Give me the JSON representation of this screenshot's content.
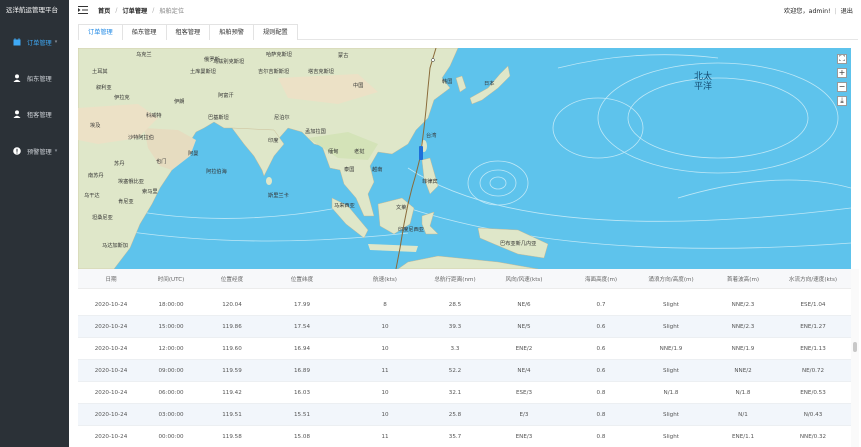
{
  "app": {
    "title": "远洋航运管理平台"
  },
  "sidebar": {
    "items": [
      {
        "label": "订单管理",
        "icon": "calendar-icon"
      },
      {
        "label": "船东管理",
        "icon": "user-icon"
      },
      {
        "label": "租客管理",
        "icon": "person-icon"
      },
      {
        "label": "预警管理",
        "icon": "alert-icon"
      }
    ]
  },
  "header": {
    "breadcrumb": [
      "首页",
      "订单管理",
      "船舶定位"
    ],
    "welcome": "欢迎您，admin!",
    "logout": "退出"
  },
  "tabs": [
    "订单管理",
    "船东管理",
    "租客管理",
    "船舶预警",
    "规则配置"
  ],
  "map": {
    "labels": {
      "kazakh": "哈萨克斯坦",
      "mongolia": "蒙古",
      "japan": "日本",
      "korea": "韩国",
      "china": "中国",
      "turkey": "土耳其",
      "iran": "伊朗",
      "afghanistan": "阿富汗",
      "pakistan": "巴基斯坦",
      "india": "印度",
      "saudi": "沙特阿拉伯",
      "egypt": "埃及",
      "yemen": "也门",
      "oman": "阿曼",
      "thailand": "泰国",
      "vietnam": "越南",
      "philippines": "菲律宾",
      "malaysia": "马来西亚",
      "indonesia": "印度尼西亚",
      "png": "巴布亚新几内亚",
      "srilanka": "斯里兰卡",
      "arabian_sea": "阿拉伯海",
      "ethiopia": "埃塞俄比亚",
      "kenya": "肯尼亚",
      "bangladesh": "孟加拉国",
      "nepal": "尼泊尔",
      "myanmar": "缅甸",
      "laos": "老挝",
      "taiwan": "台湾",
      "iraq": "伊拉克",
      "syria": "叙利亚",
      "uzbek": "乌兹别克斯坦",
      "turkmen": "土库曼斯坦",
      "kyrgyz": "吉尔吉斯斯坦",
      "tajik": "塔吉克斯坦",
      "ukraine": "乌克兰",
      "somalia": "索马里",
      "tanzania": "坦桑尼亚",
      "madagascar": "马达加斯加",
      "brunei": "文莱",
      "sudan": "苏丹",
      "south_sudan": "南苏丹",
      "russia": "俄罗斯",
      "uganda": "乌干达",
      "kuwait": "科威特"
    },
    "ocean_label": "北太平洋",
    "zoom_in": "+",
    "zoom_out": "−"
  },
  "table": {
    "headers": [
      "日期",
      "时间(UTC)",
      "位置经度",
      "位置纬度",
      "航速(kts)",
      "总航行距离(nm)",
      "风向/风速(kts)",
      "海面高度(m)",
      "涌浪方向/高度(m)",
      "首着波高(m)",
      "水流方向/速度(kts)"
    ],
    "rows": [
      [
        "2020-10-24",
        "18:00:00",
        "120.04",
        "17.99",
        "8",
        "28.5",
        "NE/6",
        "0.7",
        "Slight",
        "NNE/2.3",
        "ESE/1.04"
      ],
      [
        "2020-10-24",
        "15:00:00",
        "119.86",
        "17.54",
        "10",
        "39.3",
        "NE/5",
        "0.6",
        "Slight",
        "NNE/2.3",
        "ENE/1.27"
      ],
      [
        "2020-10-24",
        "12:00:00",
        "119.60",
        "16.94",
        "10",
        "3.3",
        "ENE/2",
        "0.6",
        "NNE/1.9",
        "NNE/1.9",
        "ENE/1.13"
      ],
      [
        "2020-10-24",
        "09:00:00",
        "119.59",
        "16.89",
        "11",
        "52.2",
        "NE/4",
        "0.6",
        "Slight",
        "NNE/2",
        "NE/0.72"
      ],
      [
        "2020-10-24",
        "06:00:00",
        "119.42",
        "16.03",
        "10",
        "32.1",
        "ESE/3",
        "0.8",
        "N/1.8",
        "N/1.8",
        "ENE/0.53"
      ],
      [
        "2020-10-24",
        "03:00:00",
        "119.51",
        "15.51",
        "10",
        "25.8",
        "E/3",
        "0.8",
        "Slight",
        "N/1",
        "N/0.43"
      ],
      [
        "2020-10-24",
        "00:00:00",
        "119.58",
        "15.08",
        "11",
        "35.7",
        "ENE/3",
        "0.8",
        "Slight",
        "ENE/1.1",
        "NNE/0.32"
      ]
    ]
  },
  "colors": {
    "sidebar": "#2b3137",
    "accent": "#1e88e5",
    "sea": "#5ec3ec",
    "land": "#dfe7c9"
  }
}
